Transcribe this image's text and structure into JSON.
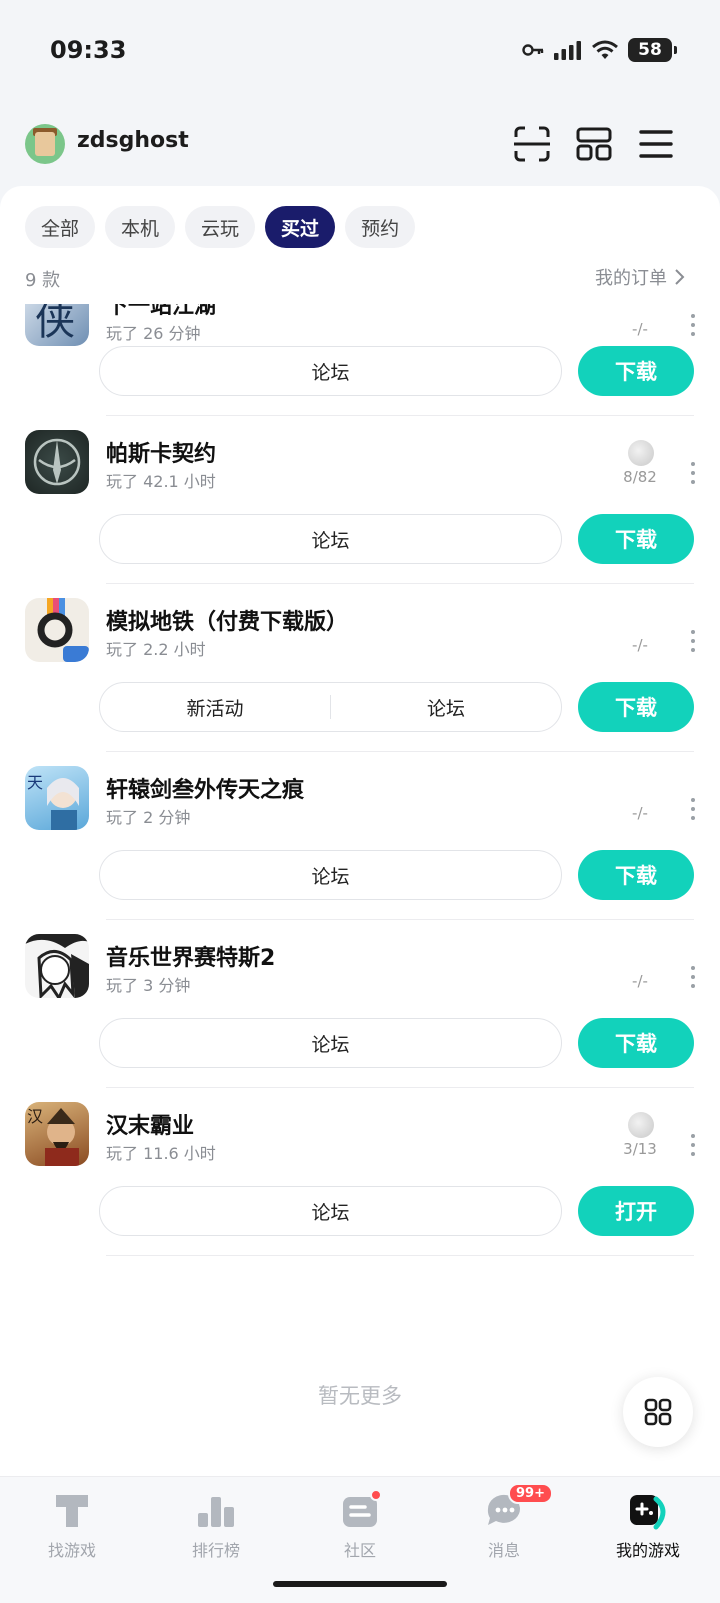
{
  "status_bar": {
    "time": "09:33",
    "battery": "58"
  },
  "header": {
    "username": "zdsghost"
  },
  "tabs": [
    {
      "label": "全部",
      "active": false
    },
    {
      "label": "本机",
      "active": false
    },
    {
      "label": "云玩",
      "active": false
    },
    {
      "label": "买过",
      "active": true
    },
    {
      "label": "预约",
      "active": false
    }
  ],
  "summary": {
    "count": "9 款",
    "orders_link": "我的订单"
  },
  "games": [
    {
      "name": "下一站江湖",
      "played": "玩了 26 分钟",
      "achievements": "-/-",
      "has_trophy": false,
      "actions": [
        "论坛"
      ],
      "primary": "下载"
    },
    {
      "name": "帕斯卡契约",
      "played": "玩了 42.1 小时",
      "achievements": "8/82",
      "has_trophy": true,
      "actions": [
        "论坛"
      ],
      "primary": "下载"
    },
    {
      "name": "模拟地铁（付费下载版）",
      "played": "玩了 2.2 小时",
      "achievements": "-/-",
      "has_trophy": false,
      "actions": [
        "新活动",
        "论坛"
      ],
      "primary": "下载"
    },
    {
      "name": "轩辕剑叁外传天之痕",
      "played": "玩了 2 分钟",
      "achievements": "-/-",
      "has_trophy": false,
      "actions": [
        "论坛"
      ],
      "primary": "下载"
    },
    {
      "name": "音乐世界赛特斯2",
      "played": "玩了 3 分钟",
      "achievements": "-/-",
      "has_trophy": false,
      "actions": [
        "论坛"
      ],
      "primary": "下载"
    },
    {
      "name": "汉末霸业",
      "played": "玩了 11.6 小时",
      "achievements": "3/13",
      "has_trophy": true,
      "actions": [
        "论坛"
      ],
      "primary": "打开"
    }
  ],
  "footer_text": "暂无更多",
  "bottom_nav": [
    {
      "label": "找游戏",
      "active": false,
      "badge": ""
    },
    {
      "label": "排行榜",
      "active": false,
      "badge": ""
    },
    {
      "label": "社区",
      "active": false,
      "badge": "dot"
    },
    {
      "label": "消息",
      "active": false,
      "badge": "99+"
    },
    {
      "label": "我的游戏",
      "active": true,
      "badge": ""
    }
  ],
  "colors": {
    "accent": "#12d2bb",
    "tab_active": "#1a1c6b"
  }
}
